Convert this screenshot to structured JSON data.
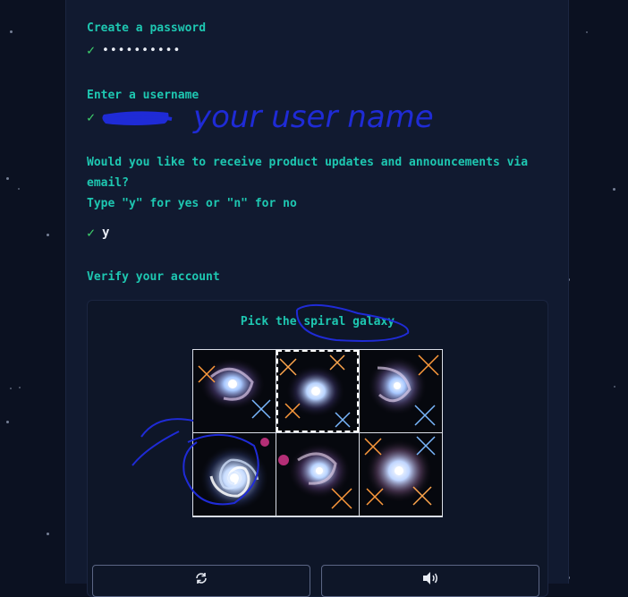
{
  "password": {
    "label": "Create a password",
    "value": "••••••••••"
  },
  "username": {
    "label": "Enter a username"
  },
  "updates": {
    "question_line1": "Would you like to receive product updates and announcements via",
    "question_line2": "email?",
    "instruction": "Type \"y\" for yes or \"n\" for no",
    "value": "y"
  },
  "verify": {
    "label": "Verify your account",
    "prompt": "Pick the spiral galaxy",
    "tiles": [
      "galaxy-tile-1",
      "galaxy-tile-2",
      "galaxy-tile-3",
      "galaxy-tile-4",
      "galaxy-tile-5",
      "galaxy-tile-6"
    ],
    "reload_icon": "refresh-icon",
    "audio_icon": "speaker-icon"
  },
  "annotation": {
    "text": "your user name"
  },
  "colors": {
    "accent": "#1ec7b1",
    "check": "#3ed16c",
    "ink": "#1f2bd6"
  }
}
